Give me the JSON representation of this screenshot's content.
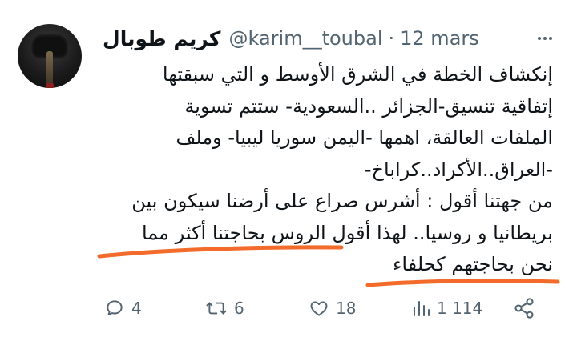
{
  "tweet": {
    "author_name": "كريم طوبال",
    "handle": "@karim__toubal",
    "separator": "·",
    "date": "12 mars",
    "lines": [
      "إنكشاف الخطة في الشرق الأوسط و التي سبقتها",
      "إتفاقية تنسيق-الجزائر ..السعودية- ستتم تسوية",
      "الملفات العالقة، اهمها -اليمن سوريا ليبيا- وملف",
      "-العراق..الأكراد..كراباخ-",
      "من جهتنا أقول : أشرس صراع على أرضنا سيكون بين",
      "بريطانيا و روسيا.. لهذا أقول الروس بحاجتنا أكثر مما",
      "نحن بحاجتهم كحلفاء"
    ]
  },
  "actions": {
    "replies": "4",
    "retweets": "6",
    "likes": "18",
    "views": "1 114"
  },
  "colors": {
    "accent_underline": "#f26b2a",
    "muted": "#536471",
    "text": "#0f1419"
  },
  "icons": [
    "more-icon",
    "reply-icon",
    "retweet-icon",
    "like-icon",
    "views-icon",
    "share-icon"
  ]
}
